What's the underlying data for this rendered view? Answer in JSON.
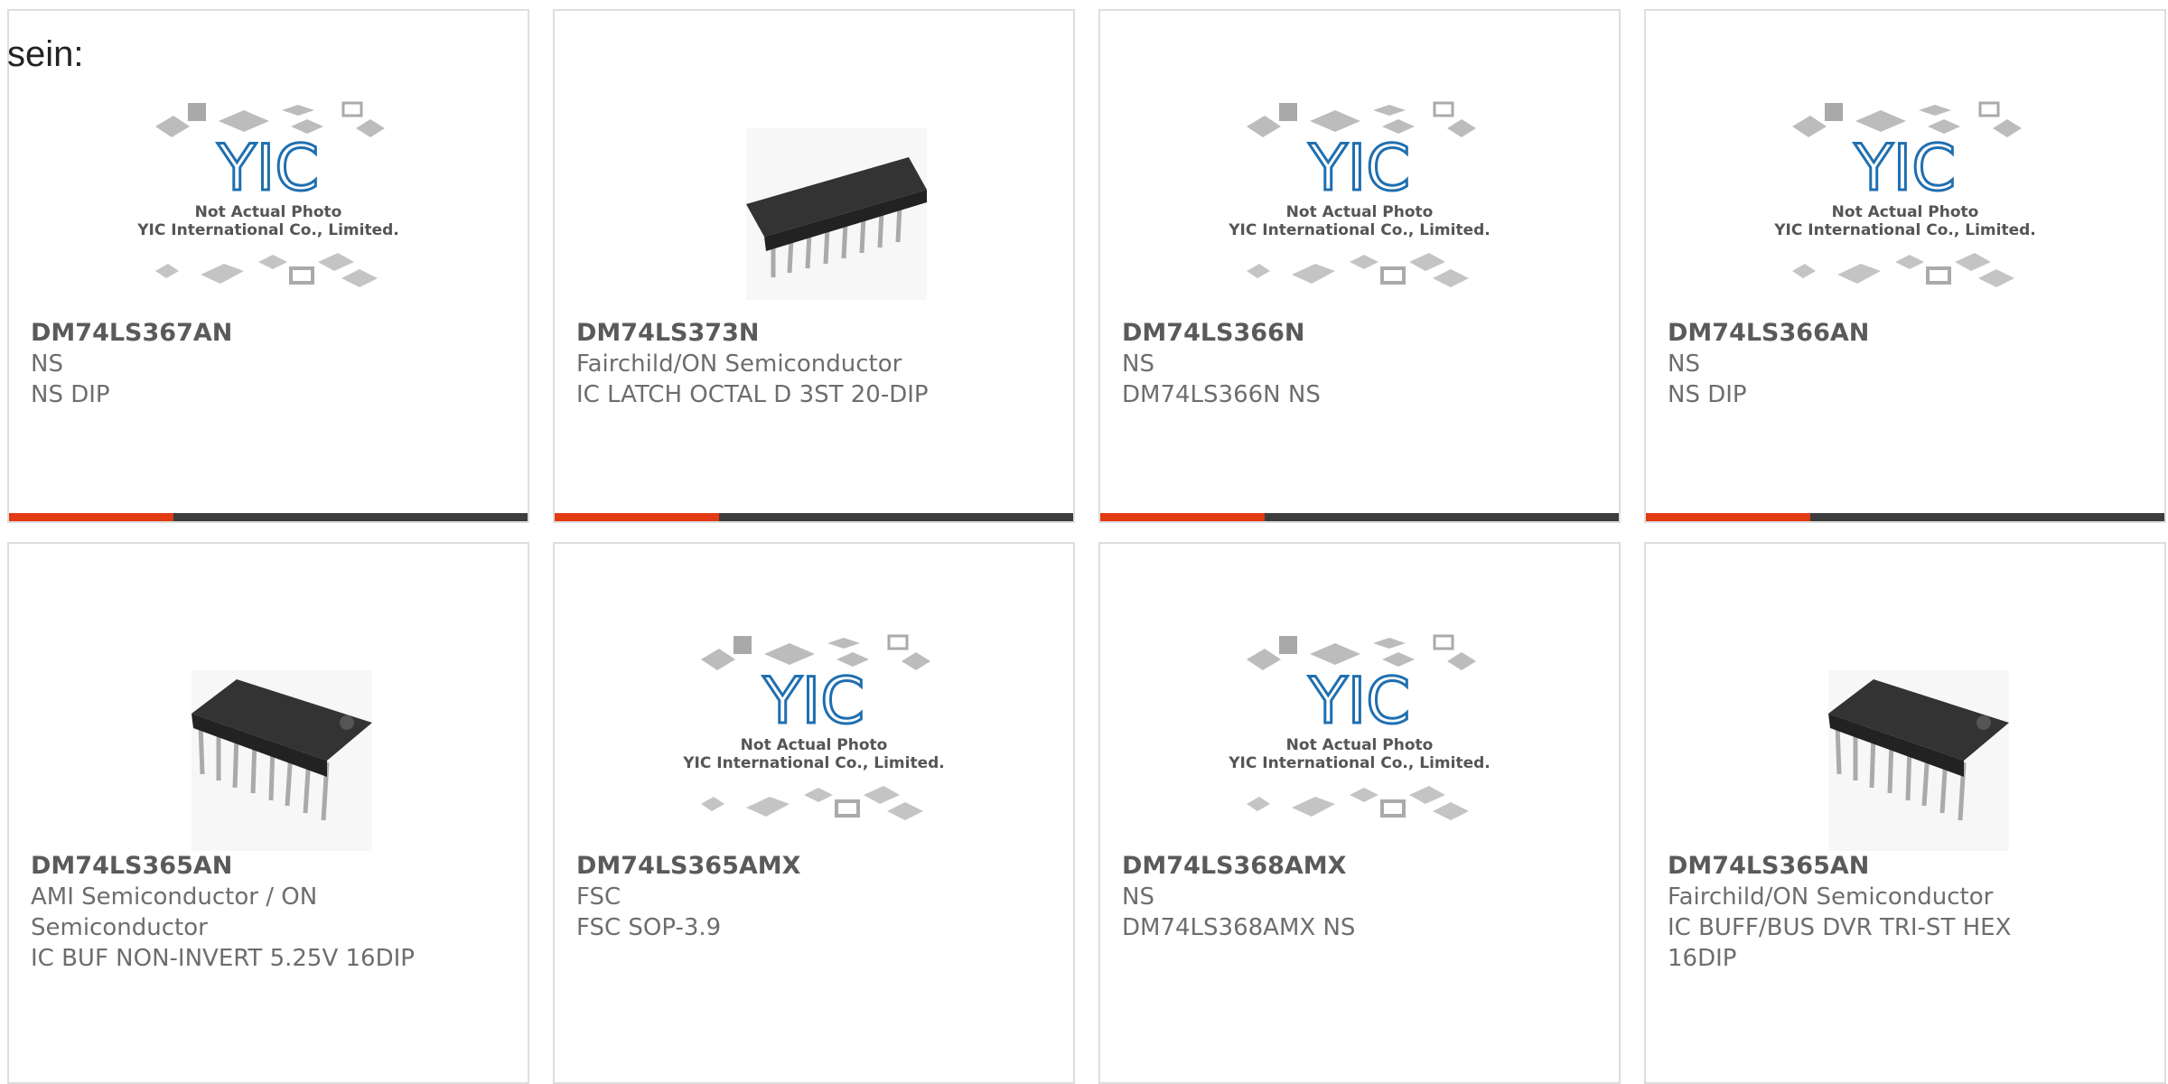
{
  "intro_text": "sein:",
  "placeholder": {
    "logo_text": "YIC",
    "line1": "Not Actual Photo",
    "line2": "YIC International Co., Limited."
  },
  "colors": {
    "accent": "#e23a12",
    "bar": "#3d3d3d",
    "text": "#6d6d6d",
    "logo": "#1f6fb0"
  },
  "products": [
    {
      "part": "DM74LS367AN",
      "maker": "NS",
      "desc": "NS DIP",
      "image": "placeholder"
    },
    {
      "part": "DM74LS373N",
      "maker": "Fairchild/ON Semiconductor",
      "desc": "IC LATCH OCTAL D 3ST 20-DIP",
      "image": "dip-chip"
    },
    {
      "part": "DM74LS366N",
      "maker": "NS",
      "desc": "DM74LS366N NS",
      "image": "placeholder"
    },
    {
      "part": "DM74LS366AN",
      "maker": "NS",
      "desc": "NS DIP",
      "image": "placeholder"
    },
    {
      "part": "DM74LS365AN",
      "maker": "AMI Semiconductor / ON Semiconductor",
      "desc": "IC BUF NON-INVERT 5.25V 16DIP",
      "image": "dip-chip"
    },
    {
      "part": "DM74LS365AMX",
      "maker": "FSC",
      "desc": "FSC SOP-3.9",
      "image": "placeholder"
    },
    {
      "part": "DM74LS368AMX",
      "maker": "NS",
      "desc": "DM74LS368AMX NS",
      "image": "placeholder"
    },
    {
      "part": "DM74LS365AN",
      "maker": "Fairchild/ON Semiconductor",
      "desc": "IC BUFF/BUS DVR TRI-ST HEX 16DIP",
      "image": "dip-chip"
    }
  ]
}
